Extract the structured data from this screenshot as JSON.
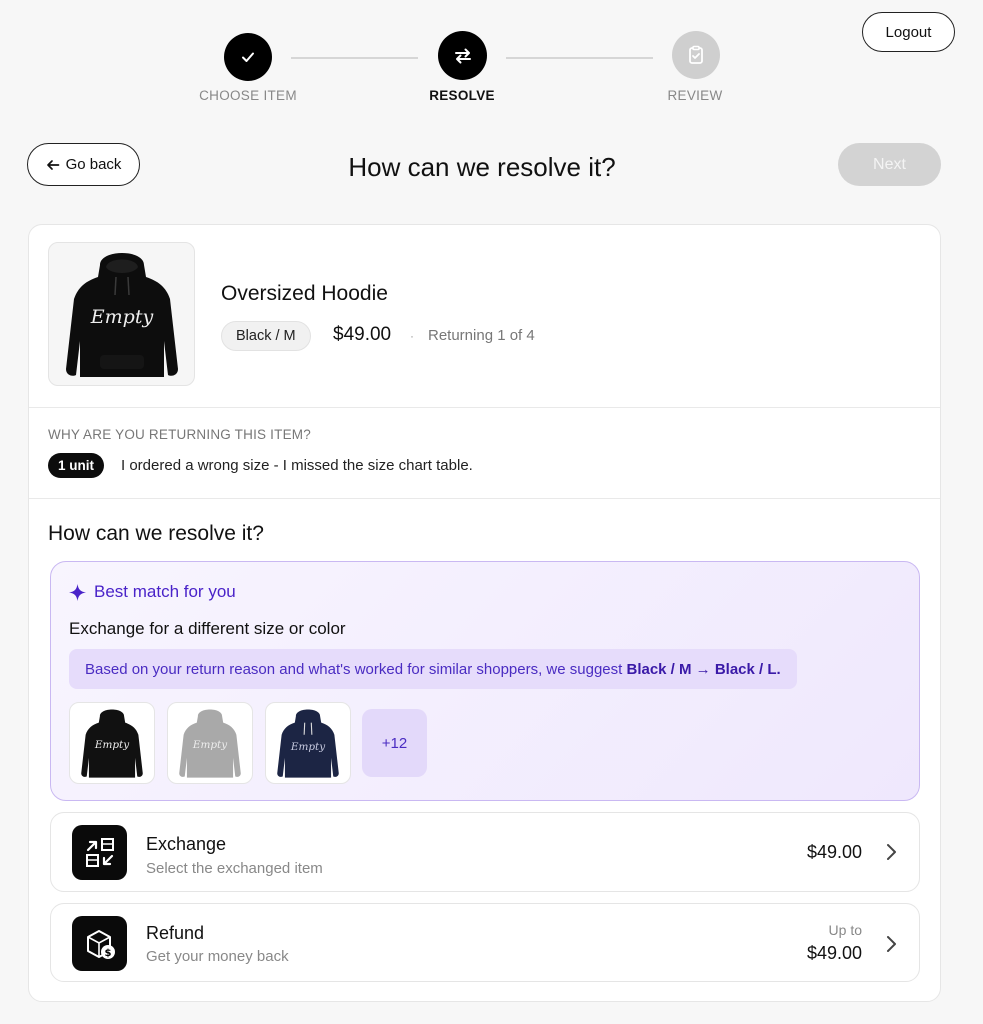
{
  "header": {
    "logout_label": "Logout"
  },
  "stepper": {
    "steps": [
      {
        "label": "CHOOSE ITEM",
        "state": "done",
        "icon": "check-icon"
      },
      {
        "label": "RESOLVE",
        "state": "active",
        "icon": "swap-icon"
      },
      {
        "label": "REVIEW",
        "state": "todo",
        "icon": "clipboard-check-icon"
      }
    ]
  },
  "nav": {
    "go_back_label": "Go back",
    "title": "How can we resolve it?",
    "next_label": "Next"
  },
  "product": {
    "name": "Oversized Hoodie",
    "variant": "Black / M",
    "price": "$49.00",
    "separator": "·",
    "returning": "Returning 1 of 4",
    "print_text": "Empty"
  },
  "reason": {
    "label": "WHY ARE YOU RETURNING THIS ITEM?",
    "units": "1 unit",
    "text": "I ordered a wrong size - I missed the size chart table."
  },
  "resolve": {
    "heading": "How can we resolve it?",
    "best_match": {
      "title": "Best match for you",
      "subtitle": "Exchange for a different size or color",
      "suggestion_prefix": "Based on your return reason and what's worked for similar shoppers, we suggest ",
      "suggestion_bold": "Black / M → Black / L.",
      "thumbs": [
        {
          "color": "black",
          "hex": "#111111"
        },
        {
          "color": "grey",
          "hex": "#a9a9a9"
        },
        {
          "color": "navy",
          "hex": "#1c2544"
        }
      ],
      "more_label": "+12"
    },
    "options": [
      {
        "title": "Exchange",
        "subtitle": "Select the exchanged item",
        "upto": "",
        "price": "$49.00",
        "icon": "exchange-boxes-icon"
      },
      {
        "title": "Refund",
        "subtitle": "Get your money back",
        "upto": "Up to",
        "price": "$49.00",
        "icon": "refund-box-icon"
      }
    ]
  },
  "colors": {
    "accent": "#4a23c9",
    "accent_bg": "#efe8fd",
    "primary": "#000000",
    "disabled": "#d3d3d3"
  }
}
